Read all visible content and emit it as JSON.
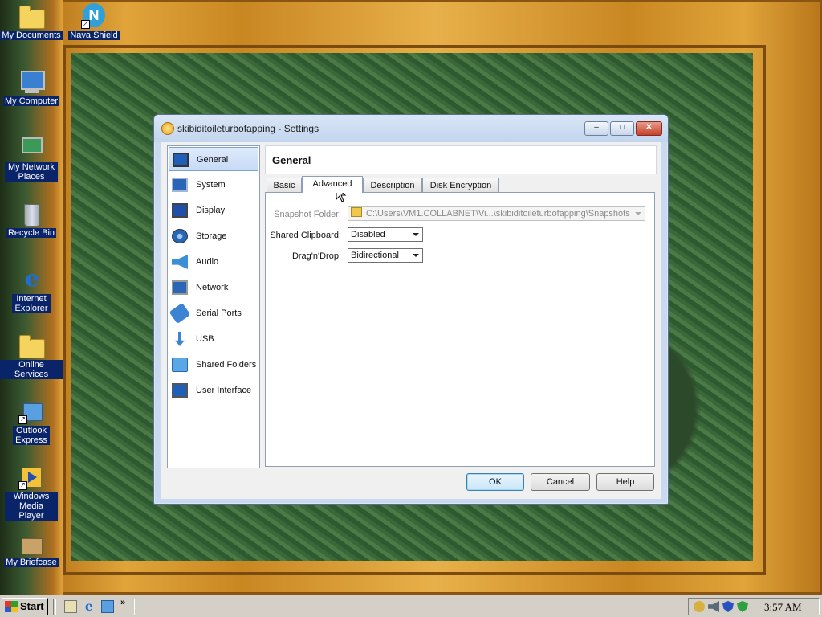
{
  "desktop": {
    "icons": [
      {
        "label": "My Documents"
      },
      {
        "label": "Nava Shield"
      },
      {
        "label": "My Computer"
      },
      {
        "label": "My Network Places"
      },
      {
        "label": "Recycle Bin"
      },
      {
        "label": "Internet Explorer"
      },
      {
        "label": "Online Services"
      },
      {
        "label": "Outlook Express"
      },
      {
        "label": "Windows Media Player"
      },
      {
        "label": "My Briefcase"
      }
    ]
  },
  "window": {
    "title": "skibiditoileturbofapping - Settings",
    "controls": {
      "minimize": "–",
      "maximize": "□",
      "close": "✕"
    }
  },
  "sidebar": {
    "items": [
      {
        "label": "General",
        "icon": "monitor-icon",
        "selected": true
      },
      {
        "label": "System",
        "icon": "chip-icon"
      },
      {
        "label": "Display",
        "icon": "display-icon"
      },
      {
        "label": "Storage",
        "icon": "disk-icon"
      },
      {
        "label": "Audio",
        "icon": "speaker-icon"
      },
      {
        "label": "Network",
        "icon": "network-icon"
      },
      {
        "label": "Serial Ports",
        "icon": "serial-port-icon"
      },
      {
        "label": "USB",
        "icon": "usb-icon"
      },
      {
        "label": "Shared Folders",
        "icon": "folder-icon"
      },
      {
        "label": "User Interface",
        "icon": "user-interface-icon"
      }
    ]
  },
  "section": {
    "title": "General"
  },
  "tabs": [
    {
      "label": "Basic"
    },
    {
      "label": "Advanced",
      "active": true
    },
    {
      "label": "Description"
    },
    {
      "label": "Disk Encryption"
    }
  ],
  "advanced": {
    "snapshot_folder": {
      "label": "Snapshot Folder:",
      "value": "C:\\Users\\VM1.COLLABNET\\Vi...\\skibiditoileturbofapping\\Snapshots",
      "enabled": false
    },
    "shared_clipboard": {
      "label": "Shared Clipboard:",
      "value": "Disabled"
    },
    "drag_n_drop": {
      "label": "Drag'n'Drop:",
      "value": "Bidirectional"
    }
  },
  "buttons": {
    "ok": "OK",
    "cancel": "Cancel",
    "help": "Help"
  },
  "taskbar": {
    "start_label": "Start",
    "clock": "3:57 AM"
  }
}
